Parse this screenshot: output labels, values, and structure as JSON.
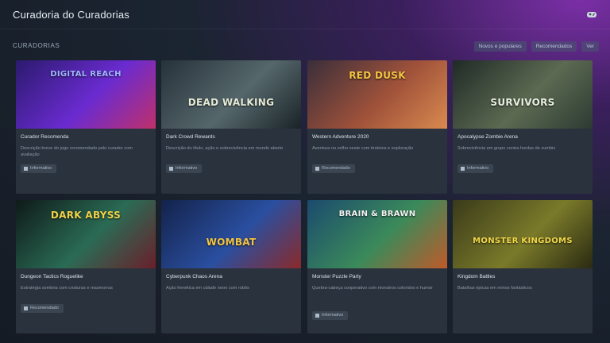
{
  "header": {
    "title": "Curadoria do Curadorias",
    "settings_icon": "gamepad-icon"
  },
  "section": {
    "label": "CURADORIAS"
  },
  "filters": [
    {
      "label": "Novos e populares"
    },
    {
      "label": "Recomendados"
    },
    {
      "label": "Ver"
    }
  ],
  "cards": [
    {
      "art_title": "DIGITAL REACH",
      "name": "Curador Recomenda",
      "desc": "Descrição breve do jogo recomendado pelo curador com avaliação",
      "tag": "Informativo",
      "colors": [
        "#2b1a6e",
        "#6a2bd0",
        "#c0306a"
      ],
      "art_color": "#9fb6ff"
    },
    {
      "art_title": "DEAD WALKING",
      "name": "Dark Crowd Rewards",
      "desc": "Descrição do título, ação e sobrevivência em mundo aberto",
      "tag": "Informativo",
      "colors": [
        "#27323a",
        "#55676b",
        "#1a2327"
      ],
      "art_color": "#e6ead6"
    },
    {
      "art_title": "RED DUSK",
      "name": "Western Adventure 2020",
      "desc": "Aventura no velho oeste com tiroteios e exploração",
      "tag": "Recomendado",
      "colors": [
        "#3a2e3a",
        "#a0523a",
        "#d98a4f"
      ],
      "art_color": "#f2c542"
    },
    {
      "art_title": "SURVIVORS",
      "name": "Apocalypse Zombie Arena",
      "desc": "Sobrevivência em grupo contra hordas de zumbis",
      "tag": "Informativo",
      "colors": [
        "#1f2a26",
        "#5c6a52",
        "#2c3a33"
      ],
      "art_color": "#e8f0e2"
    },
    {
      "art_title": "DARK ABYSS",
      "name": "Dungeon Tactics Roguelike",
      "desc": "Estratégia sombria com criaturas e masmorras",
      "tag": "Recomendado",
      "colors": [
        "#0f1a18",
        "#2a6b55",
        "#6a1f2a"
      ],
      "art_color": "#f0d24a"
    },
    {
      "art_title": "WOMBAT",
      "name": "Cyberpunk Chaos Arena",
      "desc": "Ação frenética em cidade neon com robôs",
      "tag": "",
      "colors": [
        "#13224a",
        "#2a4fa0",
        "#8a2a2a"
      ],
      "art_color": "#f2c542"
    },
    {
      "art_title": "BRAIN & BRAWN",
      "name": "Monster Puzzle Party",
      "desc": "Quebra-cabeça cooperativo com monstros coloridos e humor",
      "tag": "Informativo",
      "colors": [
        "#1b4a6e",
        "#3b8a5a",
        "#c05a2a"
      ],
      "art_color": "#f2f2f2"
    },
    {
      "art_title": "MONSTER KINGDOMS",
      "name": "Kingdom Battles",
      "desc": "Batalhas épicas em reinos fantásticos",
      "tag": "",
      "colors": [
        "#3a3a1a",
        "#7a7a2a",
        "#2a2a12"
      ],
      "art_color": "#f2d84a"
    }
  ]
}
